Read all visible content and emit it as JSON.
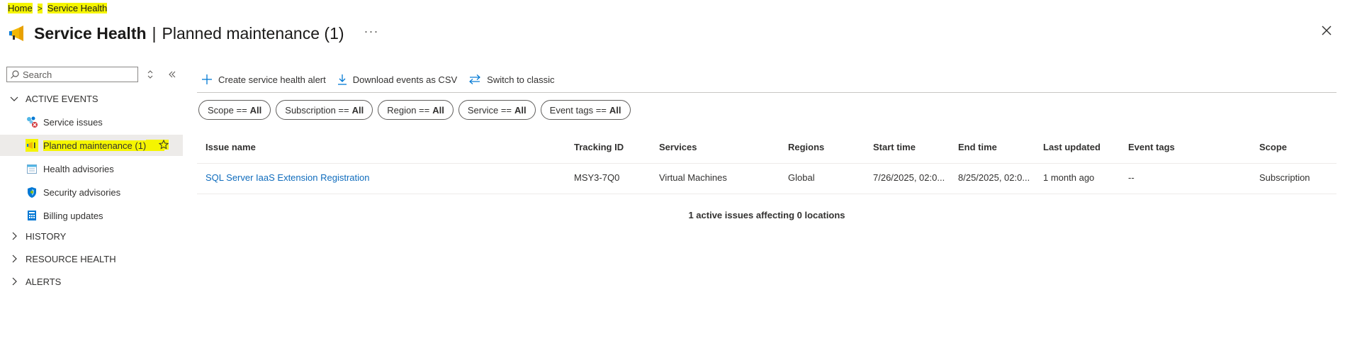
{
  "breadcrumb": {
    "home": "Home",
    "separator": ">",
    "current": "Service Health"
  },
  "header": {
    "title": "Service Health",
    "subtitle": "Planned maintenance (1)",
    "more": "···"
  },
  "sidebar": {
    "search_placeholder": "Search",
    "groups": {
      "active_events": "ACTIVE EVENTS",
      "history": "HISTORY",
      "resource_health": "RESOURCE HEALTH",
      "alerts": "ALERTS"
    },
    "items": [
      {
        "label": "Service issues",
        "icon": "service-issues-icon"
      },
      {
        "label": "Planned maintenance (1)",
        "icon": "megaphone-icon",
        "selected": true
      },
      {
        "label": "Health advisories",
        "icon": "calendar-icon"
      },
      {
        "label": "Security advisories",
        "icon": "shield-icon"
      },
      {
        "label": "Billing updates",
        "icon": "billing-icon"
      }
    ]
  },
  "toolbar": {
    "create_alert": "Create service health alert",
    "download_csv": "Download events as CSV",
    "switch_classic": "Switch to classic"
  },
  "filters": [
    {
      "key": "Scope ==",
      "value": "All"
    },
    {
      "key": "Subscription ==",
      "value": "All"
    },
    {
      "key": "Region ==",
      "value": "All"
    },
    {
      "key": "Service ==",
      "value": "All"
    },
    {
      "key": "Event tags ==",
      "value": "All"
    }
  ],
  "table": {
    "headers": {
      "issue_name": "Issue name",
      "tracking_id": "Tracking ID",
      "services": "Services",
      "regions": "Regions",
      "start_time": "Start time",
      "end_time": "End time",
      "last_updated": "Last updated",
      "event_tags": "Event tags",
      "scope": "Scope"
    },
    "rows": [
      {
        "issue_name": "SQL Server IaaS Extension Registration",
        "tracking_id": "MSY3-7Q0",
        "services": "Virtual Machines",
        "regions": "Global",
        "start_time": "7/26/2025, 02:0...",
        "end_time": "8/25/2025, 02:0...",
        "last_updated": "1 month ago",
        "event_tags": "--",
        "scope": "Subscription"
      }
    ],
    "summary": "1 active issues affecting 0 locations"
  },
  "colors": {
    "highlight": "#f5f500",
    "link": "#0f6cbd",
    "accent": "#0078d4"
  }
}
